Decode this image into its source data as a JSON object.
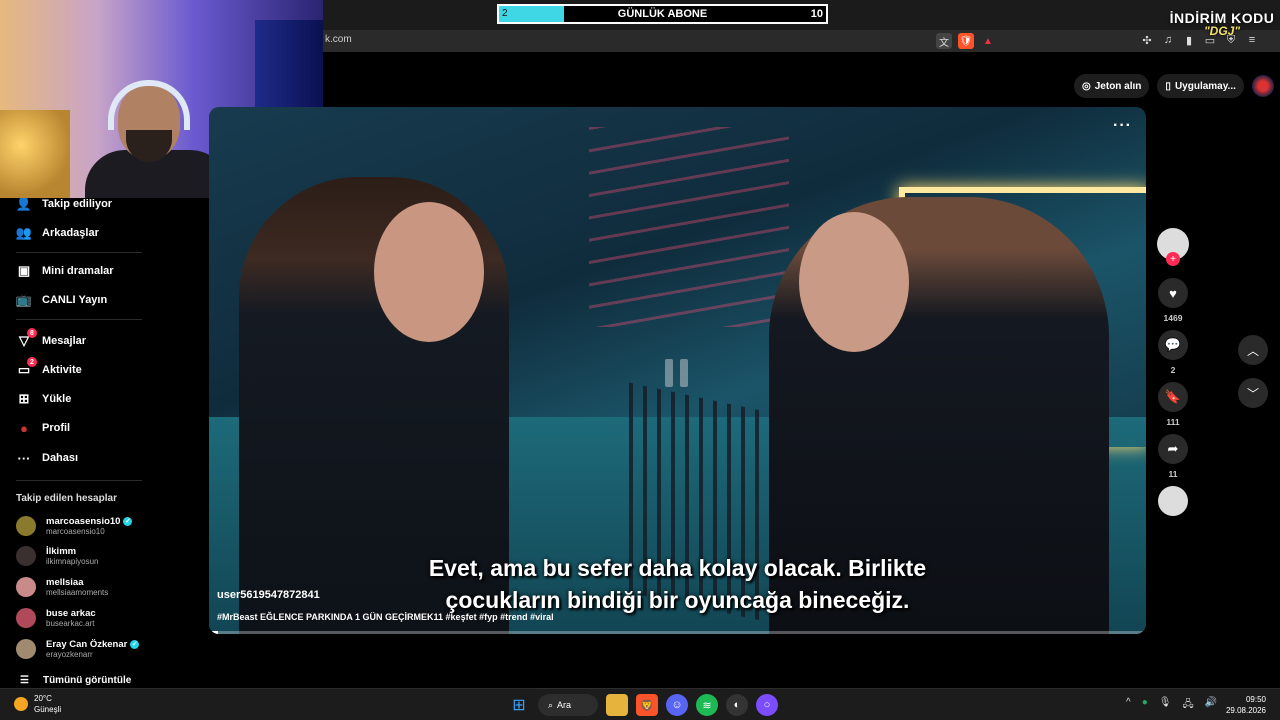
{
  "stream_overlay": {
    "sub_goal": {
      "current": "2",
      "label": "GÜNLÜK ABONE",
      "goal": "10",
      "progress_fraction": 0.2
    },
    "promo": {
      "title": "İNDİRİM KODU",
      "code": "\"DGJ\""
    }
  },
  "browser": {
    "url": "k.com"
  },
  "tiktok_header": {
    "coins_label": "Jeton alın",
    "app_label": "Uygulamay..."
  },
  "sidebar": {
    "items": [
      {
        "label": "Takip ediliyor",
        "icon": "following-icon"
      },
      {
        "label": "Arkadaşlar",
        "icon": "friends-icon"
      },
      {
        "label": "Mini dramalar",
        "icon": "mini-drama-icon"
      },
      {
        "label": "CANLI Yayın",
        "icon": "live-icon"
      },
      {
        "label": "Mesajlar",
        "icon": "messages-icon",
        "badge": "8"
      },
      {
        "label": "Aktivite",
        "icon": "activity-icon",
        "badge": "2"
      },
      {
        "label": "Yükle",
        "icon": "upload-icon"
      },
      {
        "label": "Profil",
        "icon": "profile-icon"
      },
      {
        "label": "Dahası",
        "icon": "more-icon"
      }
    ],
    "following_title": "Takip edilen hesaplar",
    "accounts": [
      {
        "name": "marcoasensio10",
        "username": "marcoasensio10",
        "verified": true,
        "color": "#8a7a2e"
      },
      {
        "name": "İlkimm",
        "username": "ilkimnapiyosun",
        "verified": false,
        "color": "#3a3030"
      },
      {
        "name": "mellsiaa",
        "username": "mellsiaamoments",
        "verified": false,
        "color": "#c98a8a"
      },
      {
        "name": "buse arkac",
        "username": "busearkac.art",
        "verified": false,
        "color": "#b04a5a"
      },
      {
        "name": "Eray Can Özkenar",
        "username": "erayozkenarr",
        "verified": true,
        "color": "#a08a70"
      }
    ],
    "see_all": "Tümünü görüntüle"
  },
  "video": {
    "subtitle_line1": "Evet, ama bu sefer daha kolay olacak. Birlikte",
    "subtitle_line2": "çocukların bindiği bir oyuncağa bineceğiz.",
    "author": "user5619547872841",
    "caption": "#MrBeast EĞLENCE PARKINDA 1 GÜN GEÇİRMEK11  #keşfet #fyp #trend #viral",
    "progress_fraction": 0.01
  },
  "actions": {
    "likes": "1469",
    "comments": "2",
    "saves": "111",
    "shares": "11"
  },
  "taskbar": {
    "temperature": "20°C",
    "weather": "Güneşli",
    "search_label": "Ara",
    "time": "09:50",
    "date": "29.08.2026"
  },
  "colors": {
    "accent_red": "#fe2c55",
    "sub_bar_fill": "#3fd6e6",
    "verified": "#20d5ec"
  }
}
